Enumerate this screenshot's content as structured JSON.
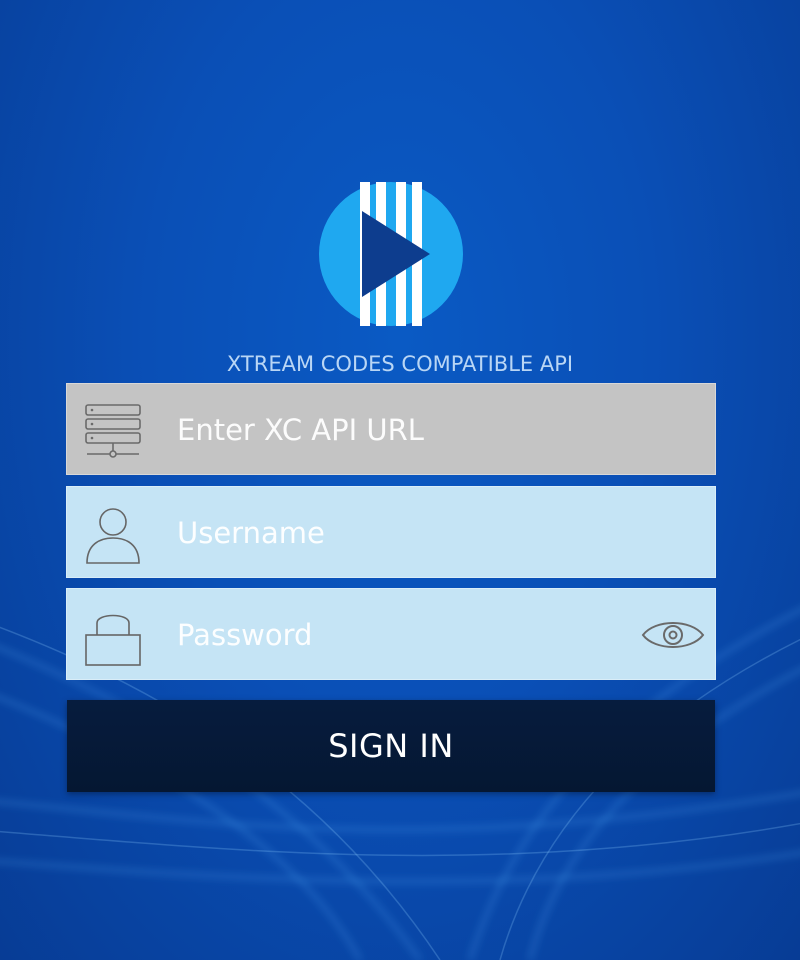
{
  "app": {
    "subtitle": "XTREAM CODES COMPATIBLE API"
  },
  "form": {
    "url_placeholder": "Enter XC API URL",
    "url_value": "",
    "username_placeholder": "Username",
    "username_value": "",
    "password_placeholder": "Password",
    "password_value": "",
    "signin_label": "SIGN IN"
  },
  "icons": {
    "logo": "play-logo-icon",
    "url": "server-icon",
    "username": "user-icon",
    "password": "lock-icon",
    "toggle": "eye-icon"
  },
  "colors": {
    "background": "#0a4fb6",
    "logo_ring": "#1fa8f0",
    "logo_play": "#0d3d8e",
    "url_field": "#c4c4c4",
    "input_field": "#c5e4f5",
    "button": "#061c3e",
    "button_text": "#ffffff"
  }
}
